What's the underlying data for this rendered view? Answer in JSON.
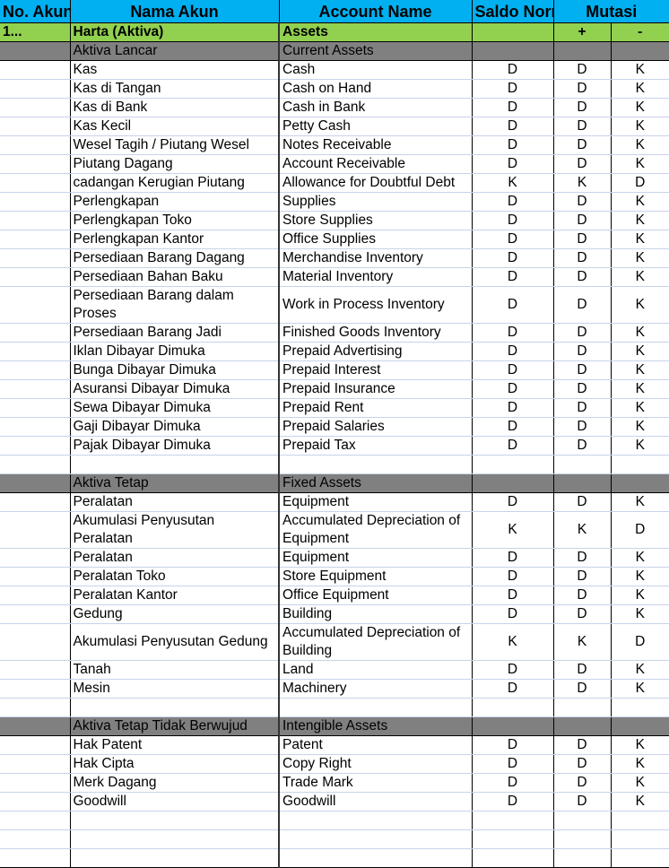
{
  "header": {
    "no_akun": "No. Akun",
    "nama_akun": "Nama Akun",
    "account_name": "Account Name",
    "saldo_normal": "Saldo Normal",
    "mutasi": "Mutasi",
    "plus": "+",
    "minus": "-"
  },
  "category": {
    "no": "1...",
    "nama": "Harta (Aktiva)",
    "account": "Assets"
  },
  "sections": [
    {
      "nama": "Aktiva Lancar",
      "account": "Current Assets",
      "rows": [
        {
          "nama": "Kas",
          "account": "Cash",
          "saldo": "D",
          "plus": "D",
          "minus": "K"
        },
        {
          "nama": "Kas di Tangan",
          "account": "Cash on Hand",
          "saldo": "D",
          "plus": "D",
          "minus": "K"
        },
        {
          "nama": "Kas di Bank",
          "account": "Cash in Bank",
          "saldo": "D",
          "plus": "D",
          "minus": "K"
        },
        {
          "nama": "Kas Kecil",
          "account": "Petty Cash",
          "saldo": "D",
          "plus": "D",
          "minus": "K"
        },
        {
          "nama": "Wesel Tagih / Piutang Wesel",
          "account": "Notes Receivable",
          "saldo": "D",
          "plus": "D",
          "minus": "K"
        },
        {
          "nama": "Piutang Dagang",
          "account": "Account Receivable",
          "saldo": "D",
          "plus": "D",
          "minus": "K"
        },
        {
          "nama": "cadangan Kerugian Piutang",
          "account": "Allowance for Doubtful Debt",
          "saldo": "K",
          "plus": "K",
          "minus": "D"
        },
        {
          "nama": "Perlengkapan",
          "account": "Supplies",
          "saldo": "D",
          "plus": "D",
          "minus": "K"
        },
        {
          "nama": "Perlengkapan Toko",
          "account": "Store Supplies",
          "saldo": "D",
          "plus": "D",
          "minus": "K"
        },
        {
          "nama": "Perlengkapan Kantor",
          "account": "Office Supplies",
          "saldo": "D",
          "plus": "D",
          "minus": "K"
        },
        {
          "nama": "Persediaan Barang Dagang",
          "account": "Merchandise Inventory",
          "saldo": "D",
          "plus": "D",
          "minus": "K"
        },
        {
          "nama": "Persediaan Bahan Baku",
          "account": "Material Inventory",
          "saldo": "D",
          "plus": "D",
          "minus": "K"
        },
        {
          "nama": "Persediaan Barang dalam Proses",
          "account": "Work in Process Inventory",
          "saldo": "D",
          "plus": "D",
          "minus": "K",
          "tall": true
        },
        {
          "nama": "Persediaan Barang Jadi",
          "account": "Finished Goods Inventory",
          "saldo": "D",
          "plus": "D",
          "minus": "K"
        },
        {
          "nama": "Iklan Dibayar Dimuka",
          "account": "Prepaid Advertising",
          "saldo": "D",
          "plus": "D",
          "minus": "K"
        },
        {
          "nama": "Bunga Dibayar Dimuka",
          "account": "Prepaid Interest",
          "saldo": "D",
          "plus": "D",
          "minus": "K"
        },
        {
          "nama": "Asuransi Dibayar Dimuka",
          "account": "Prepaid Insurance",
          "saldo": "D",
          "plus": "D",
          "minus": "K"
        },
        {
          "nama": "Sewa Dibayar Dimuka",
          "account": "Prepaid Rent",
          "saldo": "D",
          "plus": "D",
          "minus": "K"
        },
        {
          "nama": "Gaji Dibayar Dimuka",
          "account": "Prepaid Salaries",
          "saldo": "D",
          "plus": "D",
          "minus": "K"
        },
        {
          "nama": "Pajak Dibayar Dimuka",
          "account": "Prepaid Tax",
          "saldo": "D",
          "plus": "D",
          "minus": "K"
        },
        {
          "nama": "",
          "account": "",
          "saldo": "",
          "plus": "",
          "minus": ""
        }
      ]
    },
    {
      "nama": "Aktiva Tetap",
      "account": "Fixed Assets",
      "rows": [
        {
          "nama": "Peralatan",
          "account": "Equipment",
          "saldo": "D",
          "plus": "D",
          "minus": "K"
        },
        {
          "nama": "Akumulasi Penyusutan Peralatan",
          "account": "Accumulated Depreciation of Equipment",
          "saldo": "K",
          "plus": "K",
          "minus": "D",
          "tall": true
        },
        {
          "nama": "Peralatan",
          "account": "Equipment",
          "saldo": "D",
          "plus": "D",
          "minus": "K"
        },
        {
          "nama": "Peralatan Toko",
          "account": "Store Equipment",
          "saldo": "D",
          "plus": "D",
          "minus": "K"
        },
        {
          "nama": "Peralatan Kantor",
          "account": "Office Equipment",
          "saldo": "D",
          "plus": "D",
          "minus": "K"
        },
        {
          "nama": "Gedung",
          "account": "Building",
          "saldo": "D",
          "plus": "D",
          "minus": "K"
        },
        {
          "nama": "Akumulasi Penyusutan Gedung",
          "account": "Accumulated Depreciation of Building",
          "saldo": "K",
          "plus": "K",
          "minus": "D",
          "tall": true
        },
        {
          "nama": "Tanah",
          "account": "Land",
          "saldo": "D",
          "plus": "D",
          "minus": "K"
        },
        {
          "nama": "Mesin",
          "account": "Machinery",
          "saldo": "D",
          "plus": "D",
          "minus": "K"
        },
        {
          "nama": "",
          "account": "",
          "saldo": "",
          "plus": "",
          "minus": ""
        }
      ]
    },
    {
      "nama": "Aktiva Tetap Tidak Berwujud",
      "account": "Intengible Assets",
      "rows": [
        {
          "nama": "Hak Patent",
          "account": "Patent",
          "saldo": "D",
          "plus": "D",
          "minus": "K"
        },
        {
          "nama": "Hak Cipta",
          "account": "Copy Right",
          "saldo": "D",
          "plus": "D",
          "minus": "K"
        },
        {
          "nama": "Merk Dagang",
          "account": "Trade Mark",
          "saldo": "D",
          "plus": "D",
          "minus": "K"
        },
        {
          "nama": "Goodwill",
          "account": "Goodwill",
          "saldo": "D",
          "plus": "D",
          "minus": "K"
        },
        {
          "nama": "",
          "account": "",
          "saldo": "",
          "plus": "",
          "minus": ""
        },
        {
          "nama": "",
          "account": "",
          "saldo": "",
          "plus": "",
          "minus": ""
        },
        {
          "nama": "",
          "account": "",
          "saldo": "",
          "plus": "",
          "minus": ""
        }
      ]
    }
  ]
}
